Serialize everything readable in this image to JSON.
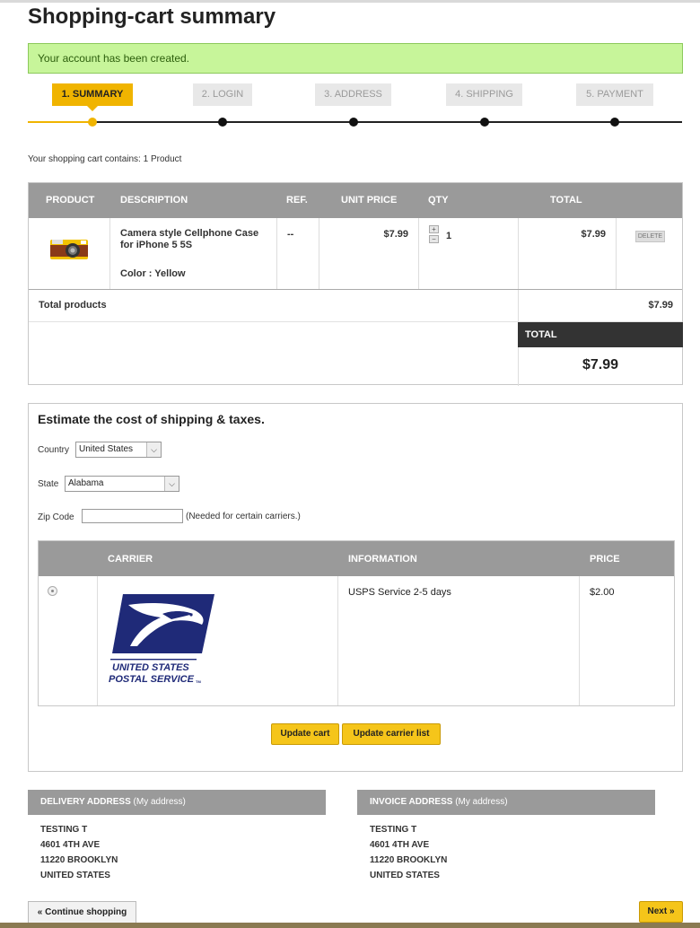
{
  "page": {
    "title": "Shopping-cart summary",
    "alert": "Your account has been created."
  },
  "steps": [
    {
      "label": "1. SUMMARY",
      "active": true
    },
    {
      "label": "2. LOGIN",
      "active": false
    },
    {
      "label": "3. ADDRESS",
      "active": false
    },
    {
      "label": "4. SHIPPING",
      "active": false
    },
    {
      "label": "5. PAYMENT",
      "active": false
    }
  ],
  "cart": {
    "count_text": "Your shopping cart contains: 1 Product",
    "headers": {
      "product": "PRODUCT",
      "description": "DESCRIPTION",
      "ref": "REF.",
      "unit_price": "UNIT PRICE",
      "qty": "QTY",
      "total": "TOTAL"
    },
    "item": {
      "name": "Camera style Cellphone Case for iPhone 5 5S",
      "color": "Color : Yellow",
      "ref": "--",
      "unit_price": "$7.99",
      "qty": "1",
      "total": "$7.99",
      "delete_label": "DELETE",
      "qty_plus": "+",
      "qty_minus": "−"
    },
    "total_products_label": "Total products",
    "total_products_value": "$7.99",
    "total_label": "TOTAL",
    "total_value": "$7.99"
  },
  "estimate": {
    "title": "Estimate the cost of shipping & taxes.",
    "country_label": "Country",
    "country_value": "United States",
    "state_label": "State",
    "state_value": "Alabama",
    "zip_label": "Zip Code",
    "zip_value": "",
    "zip_note": "(Needed for certain carriers.)",
    "carrier_headers": {
      "carrier": "CARRIER",
      "information": "INFORMATION",
      "price": "PRICE"
    },
    "carrier": {
      "logo_text_1": "UNITED STATES",
      "logo_text_2": "POSTAL SERVICE",
      "logo_mark": "TM",
      "info": "USPS Service 2-5 days",
      "price": "$2.00"
    },
    "update_cart_label": "Update cart",
    "update_carrier_label": "Update carrier list"
  },
  "delivery": {
    "title": "DELIVERY ADDRESS",
    "subtitle": "(My address)",
    "lines": [
      "TESTING T",
      "4601 4TH AVE",
      "11220 BROOKLYN",
      "UNITED STATES"
    ]
  },
  "invoice": {
    "title": "INVOICE ADDRESS",
    "subtitle": "(My address)",
    "lines": [
      "TESTING T",
      "4601 4TH AVE",
      "11220 BROOKLYN",
      "UNITED STATES"
    ]
  },
  "nav": {
    "continue_label": "« Continue shopping",
    "next_label": "Next »"
  },
  "colors": {
    "accent": "#f0b400",
    "alert_bg": "#c7f59a",
    "header_grey": "#9a9a9a",
    "usps_blue": "#1f2a78"
  }
}
